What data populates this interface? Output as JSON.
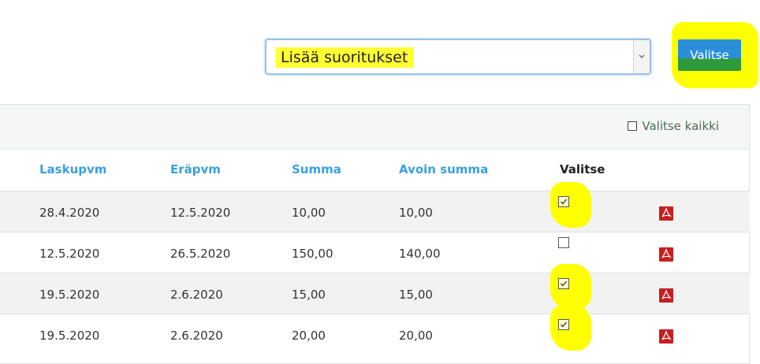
{
  "action_bar": {
    "select_value": "Lisää suoritukset",
    "submit_label": "Valitse"
  },
  "panel": {
    "select_all_label": "Valitse kaikki"
  },
  "table": {
    "headers": [
      "Laskupvm",
      "Eräpvm",
      "Summa",
      "Avoin summa",
      "Valitse"
    ],
    "rows": [
      {
        "laskupvm": "28.4.2020",
        "erapvm": "12.5.2020",
        "summa": "10,00",
        "avoin": "10,00",
        "checked": true,
        "highlighted": true
      },
      {
        "laskupvm": "12.5.2020",
        "erapvm": "26.5.2020",
        "summa": "150,00",
        "avoin": "140,00",
        "checked": false,
        "highlighted": false
      },
      {
        "laskupvm": "19.5.2020",
        "erapvm": "2.6.2020",
        "summa": "15,00",
        "avoin": "15,00",
        "checked": true,
        "highlighted": true
      },
      {
        "laskupvm": "19.5.2020",
        "erapvm": "2.6.2020",
        "summa": "20,00",
        "avoin": "20,00",
        "checked": true,
        "highlighted": true
      }
    ]
  },
  "icons": {
    "pdf": "pdf-icon",
    "dropdown": "chevron-down-icon"
  },
  "colors": {
    "header_link": "#3b9fe0",
    "highlight": "#ffff00",
    "pdf": "#c81e1e"
  }
}
